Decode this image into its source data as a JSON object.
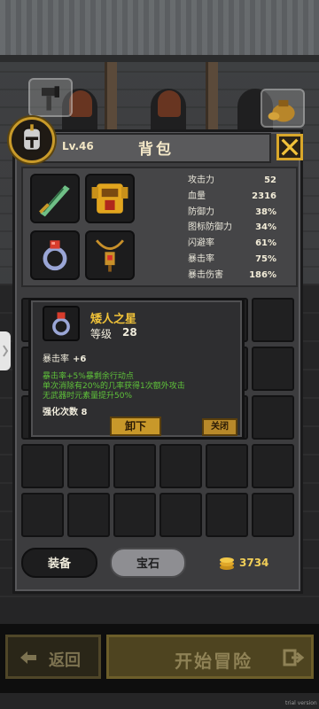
{
  "hud": {
    "left_icon": "hammer-icon",
    "right_icon": "money-bag-icon"
  },
  "panel": {
    "title": "背包",
    "level": "Lv.46",
    "avatar_icon": "knight-helmet-icon",
    "close_icon": "close-icon"
  },
  "equipment": [
    {
      "name": "feather-weapon",
      "icon": "feather-sword-icon"
    },
    {
      "name": "armor",
      "icon": "golden-armor-icon"
    },
    {
      "name": "ring",
      "icon": "ring-icon"
    },
    {
      "name": "amulet",
      "icon": "amulet-icon"
    }
  ],
  "stats": [
    {
      "label": "攻击力",
      "value": "52"
    },
    {
      "label": "血量",
      "value": "2316"
    },
    {
      "label": "防御力",
      "value": "38%"
    },
    {
      "label": "图标防御力",
      "value": "34%"
    },
    {
      "label": "闪避率",
      "value": "61%"
    },
    {
      "label": "暴击率",
      "value": "75%"
    },
    {
      "label": "暴击伤害",
      "value": "186%"
    }
  ],
  "popup": {
    "item_name": "矮人之星",
    "level_label": "等级",
    "level_value": "28",
    "main_stat": "暴击率",
    "main_stat_value": "+6",
    "effects": [
      "暴击率+5%暴剩余行动点",
      "单次消除有20%的几率获得1次额外攻击",
      "无武器时元素量提升50%"
    ],
    "enhance": "强化次数 8",
    "unequip_label": "卸下",
    "close_label": "关闭"
  },
  "tabs": {
    "equip": "装备",
    "gem": "宝石"
  },
  "gold": {
    "amount": "3734",
    "icon": "gold-coins-icon"
  },
  "actions": {
    "back": "返回",
    "start": "开始冒险"
  },
  "watermark": "trial version",
  "colors": {
    "accent_gold": "#d9a72a",
    "effect_green": "#5fc23a",
    "item_name": "#f0c238"
  }
}
